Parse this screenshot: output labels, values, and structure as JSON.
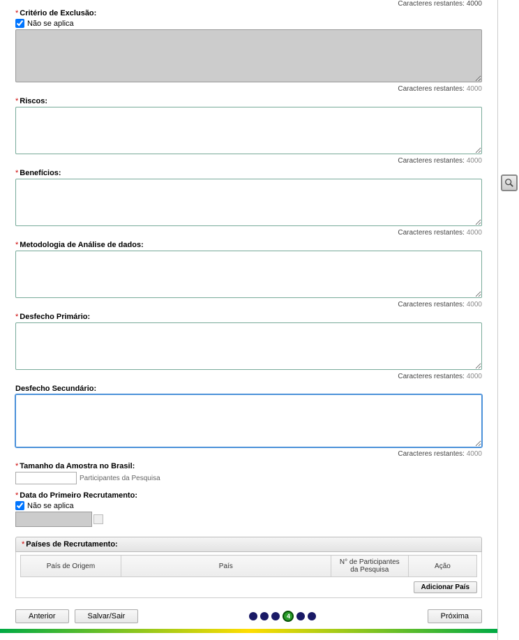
{
  "charTop": {
    "label": "Caracteres restantes:",
    "count": "4000"
  },
  "fields": {
    "exclusion": {
      "label": "Critério de Exclusão:",
      "naoAplica": "Não se aplica",
      "charLabel": "Caracteres restantes:",
      "charCount": "4000"
    },
    "riscos": {
      "label": "Riscos:",
      "charLabel": "Caracteres restantes:",
      "charCount": "4000"
    },
    "beneficios": {
      "label": "Benefícios:",
      "charLabel": "Caracteres restantes:",
      "charCount": "4000"
    },
    "metodologia": {
      "label": "Metodologia de Análise de dados:",
      "charLabel": "Caracteres restantes:",
      "charCount": "4000"
    },
    "desfechoPrimario": {
      "label": "Desfecho Primário:",
      "charLabel": "Caracteres restantes:",
      "charCount": "4000"
    },
    "desfechoSecundario": {
      "label": "Desfecho Secundário:",
      "charLabel": "Caracteres restantes:",
      "charCount": "4000"
    },
    "tamanhoAmostra": {
      "label": "Tamanho da Amostra no Brasil:",
      "hint": "Participantes da Pesquisa"
    },
    "dataPrimeiro": {
      "label": "Data do Primeiro Recrutamento:",
      "naoAplica": "Não se aplica"
    }
  },
  "paises": {
    "header": "Países de Recrutamento:",
    "cols": {
      "origem": "País de Origem",
      "pais": "País",
      "participantes": "N° de Participantes da Pesquisa",
      "acao": "Ação"
    },
    "addBtn": "Adicionar País"
  },
  "footer": {
    "anterior": "Anterior",
    "salvar": "Salvar/Sair",
    "proxima": "Próxima",
    "activeStep": "4"
  }
}
